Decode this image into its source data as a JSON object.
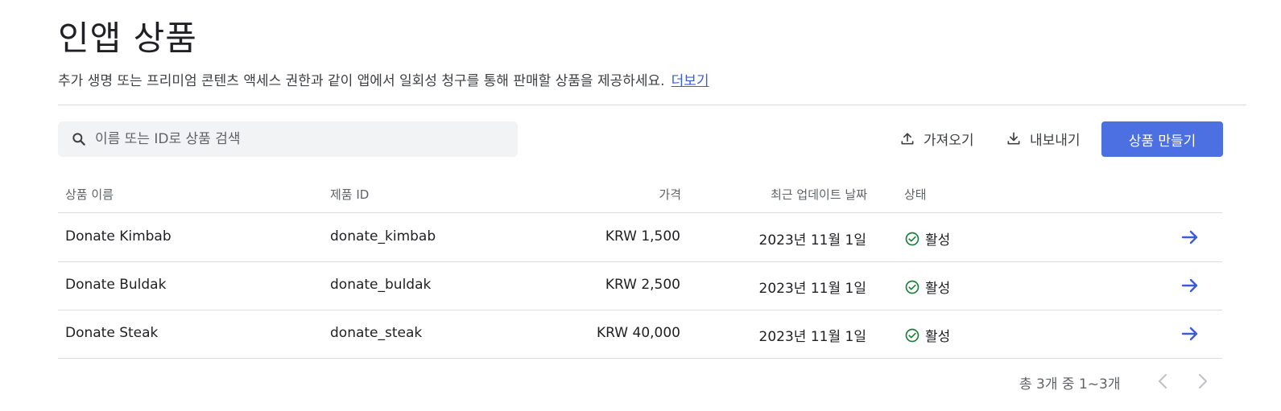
{
  "header": {
    "title": "인앱 상품",
    "description": "추가 생명 또는 프리미엄 콘텐츠 액세스 권한과 같이 앱에서 일회성 청구를 통해 판매할 상품을 제공하세요.",
    "learn_more": "더보기"
  },
  "toolbar": {
    "search_placeholder": "이름 또는 ID로 상품 검색",
    "import_label": "가져오기",
    "export_label": "내보내기",
    "create_label": "상품 만들기"
  },
  "table": {
    "headers": {
      "name": "상품 이름",
      "id": "제품 ID",
      "price": "가격",
      "updated": "최근 업데이트 날짜",
      "status": "상태"
    },
    "rows": [
      {
        "name": "Donate Kimbab",
        "id": "donate_kimbab",
        "price": "KRW 1,500",
        "updated": "2023년 11월 1일",
        "status": "활성"
      },
      {
        "name": "Donate Buldak",
        "id": "donate_buldak",
        "price": "KRW 2,500",
        "updated": "2023년 11월 1일",
        "status": "활성"
      },
      {
        "name": "Donate Steak",
        "id": "donate_steak",
        "price": "KRW 40,000",
        "updated": "2023년 11월 1일",
        "status": "활성"
      }
    ]
  },
  "pagination": {
    "summary": "총 3개 중 1~3개"
  },
  "icons": {
    "search": "search-icon",
    "import": "upload-icon",
    "export": "download-icon",
    "status_active": "check-circle-icon",
    "row_open": "arrow-right-icon",
    "prev": "chevron-left-icon",
    "next": "chevron-right-icon"
  },
  "colors": {
    "primary": "#4c6fe2",
    "link": "#3c5bd6",
    "active_status": "#188038",
    "arrow": "#3c5bd6"
  }
}
